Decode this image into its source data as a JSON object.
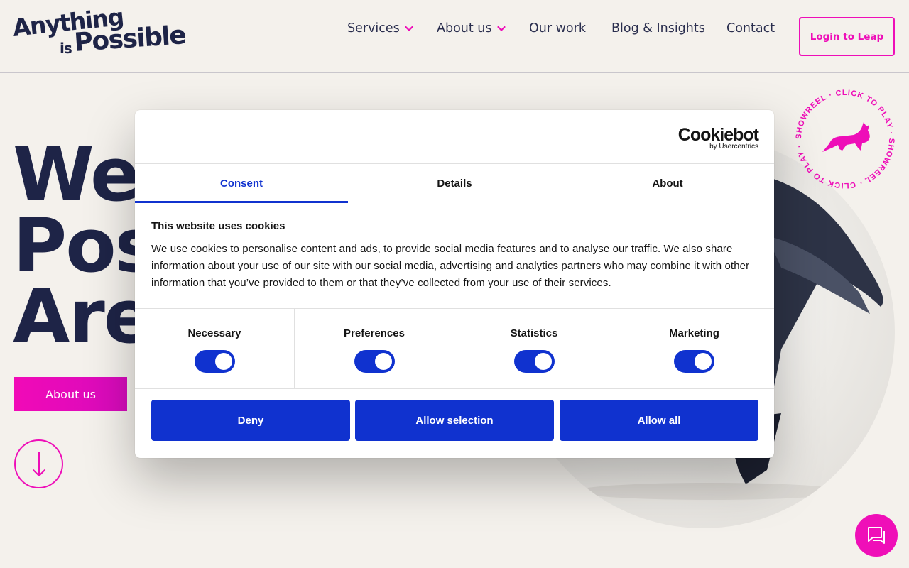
{
  "header": {
    "logo": {
      "line1": "Anything",
      "is": "is",
      "line2": "Possible"
    },
    "nav": [
      {
        "label": "Services",
        "has_dropdown": true
      },
      {
        "label": "About us",
        "has_dropdown": true
      },
      {
        "label": "Our work",
        "has_dropdown": false
      },
      {
        "label": "Blog & Insights",
        "has_dropdown": false
      },
      {
        "label": "Contact",
        "has_dropdown": false
      }
    ],
    "login_label": "Login to Leap"
  },
  "hero": {
    "title_lines": [
      "We",
      "Pos",
      "Are"
    ],
    "about_button": "About us",
    "showreel_text": "SHOWREEL · CLICK TO PLAY · SHOWREEL · CLICK TO PLAY ·"
  },
  "cookie": {
    "brand": "Cookiebot",
    "brand_sub": "by Usercentrics",
    "tabs": [
      "Consent",
      "Details",
      "About"
    ],
    "active_tab": "Consent",
    "title": "This website uses cookies",
    "text": "We use cookies to personalise content and ads, to provide social media features and to analyse our traffic. We also share information about your use of our site with our social media, advertising and analytics partners who may combine it with other information that you’ve provided to them or that they’ve collected from your use of their services.",
    "categories": [
      {
        "label": "Necessary",
        "enabled": true
      },
      {
        "label": "Preferences",
        "enabled": true
      },
      {
        "label": "Statistics",
        "enabled": true
      },
      {
        "label": "Marketing",
        "enabled": true
      }
    ],
    "buttons": {
      "deny": "Deny",
      "selection": "Allow selection",
      "all": "Allow all"
    }
  },
  "colors": {
    "background": "#f4f1ec",
    "navy": "#1e2447",
    "magenta": "#ee0eb8",
    "cookie_blue": "#1032cf"
  },
  "icons": {
    "nav_dropdown": "chevron-down-icon",
    "scroll": "arrow-down-icon",
    "showreel": "goat-icon",
    "chat": "chat-icon"
  }
}
